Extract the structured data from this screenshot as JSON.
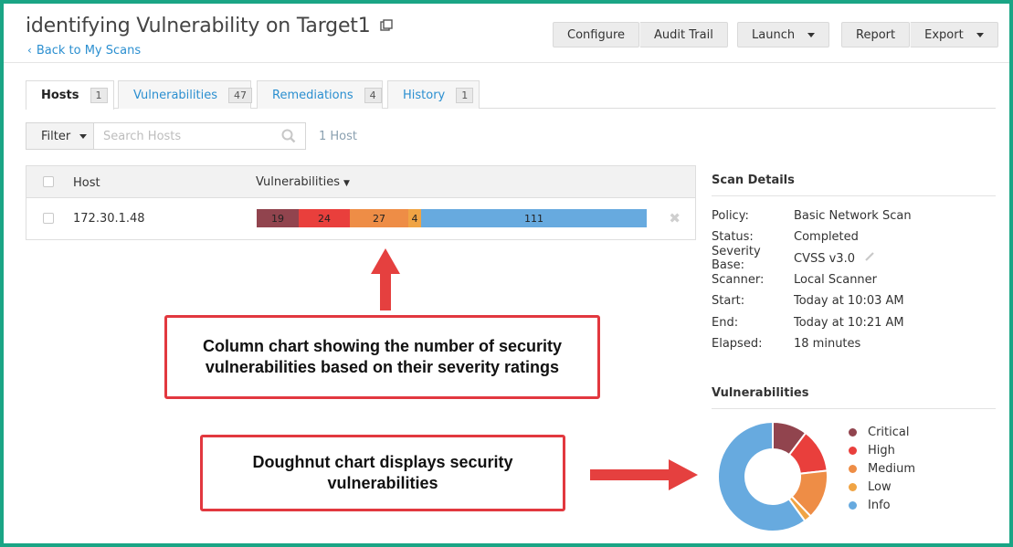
{
  "header": {
    "title": "identifying Vulnerability on Target1",
    "back_link": "Back to My Scans",
    "buttons": {
      "configure": "Configure",
      "audit_trail": "Audit Trail",
      "launch": "Launch",
      "report": "Report",
      "export": "Export"
    }
  },
  "tabs": [
    {
      "label": "Hosts",
      "count": "1",
      "active": true
    },
    {
      "label": "Vulnerabilities",
      "count": "47",
      "active": false
    },
    {
      "label": "Remediations",
      "count": "4",
      "active": false
    },
    {
      "label": "History",
      "count": "1",
      "active": false
    }
  ],
  "filter": {
    "button_label": "Filter",
    "search_placeholder": "Search Hosts",
    "host_count": "1 Host"
  },
  "table": {
    "columns": {
      "host": "Host",
      "vulnerabilities": "Vulnerabilities"
    },
    "rows": [
      {
        "host": "172.30.1.48"
      }
    ]
  },
  "callouts": {
    "column": "Column chart showing the number of security vulnerabilities based on their severity ratings",
    "doughnut": "Doughnut chart displays security vulnerabilities"
  },
  "scan_details": {
    "title": "Scan Details",
    "items": [
      {
        "key": "Policy:",
        "value": "Basic Network Scan"
      },
      {
        "key": "Status:",
        "value": "Completed"
      },
      {
        "key": "Severity Base:",
        "value": "CVSS v3.0"
      },
      {
        "key": "Scanner:",
        "value": "Local Scanner"
      },
      {
        "key": "Start:",
        "value": "Today at 10:03 AM"
      },
      {
        "key": "End:",
        "value": "Today at 10:21 AM"
      },
      {
        "key": "Elapsed:",
        "value": "18 minutes"
      }
    ]
  },
  "vulnerabilities_section": {
    "title": "Vulnerabilities"
  },
  "colors": {
    "critical": "#91444e",
    "high": "#e93f3c",
    "medium": "#ee8d46",
    "low": "#f0a444",
    "info": "#67aadf",
    "link": "#2b8fd0",
    "frame": "#1aa585",
    "callout_border": "#e2383f"
  },
  "chart_data": [
    {
      "type": "bar",
      "orientation": "stacked-horizontal",
      "categories": [
        "Critical",
        "High",
        "Medium",
        "Low",
        "Info"
      ],
      "values": [
        19,
        24,
        27,
        4,
        111
      ]
    },
    {
      "type": "pie",
      "subtype": "doughnut",
      "categories": [
        "Critical",
        "High",
        "Medium",
        "Low",
        "Info"
      ],
      "values": [
        19,
        24,
        27,
        4,
        111
      ]
    }
  ]
}
